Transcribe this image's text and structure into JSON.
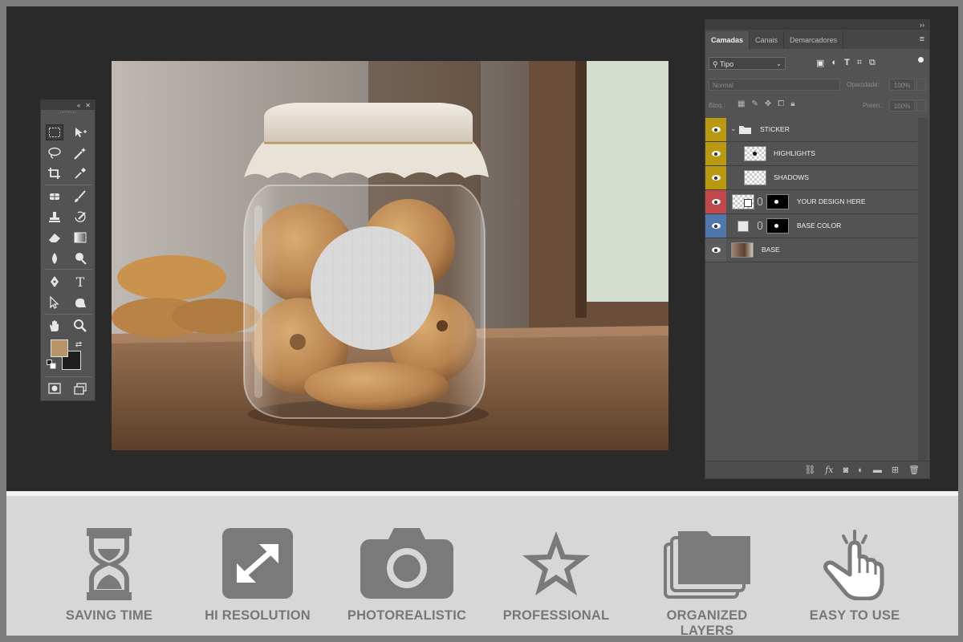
{
  "layers_panel": {
    "tabs": [
      {
        "label": "Camadas",
        "active": true
      },
      {
        "label": "Canais",
        "active": false
      },
      {
        "label": "Demarcadores",
        "active": false
      }
    ],
    "filter_label": "Tipo",
    "blend_mode": "Normal",
    "opacity_label": "Opacidade:",
    "opacity_value": "100%",
    "lock_label": "Bloq.:",
    "fill_label": "Preen.:",
    "fill_value": "100%",
    "layers": [
      {
        "name": "STICKER",
        "color": "#b8990f",
        "type": "group"
      },
      {
        "name": "HIGHLIGHTS",
        "color": "#b8990f",
        "type": "layer"
      },
      {
        "name": "SHADOWS",
        "color": "#b8990f",
        "type": "layer"
      },
      {
        "name": "YOUR DESIGN HERE",
        "color": "#c0484d",
        "type": "smart"
      },
      {
        "name": "BASE COLOR",
        "color": "#5077ab",
        "type": "fill"
      },
      {
        "name": "BASE",
        "color": "#5c5c5c",
        "type": "image"
      }
    ]
  },
  "toolbox": {
    "foreground_color": "#b8946a",
    "background_color": "#1e1e1e"
  },
  "features": [
    {
      "label": "SAVING TIME",
      "icon": "hourglass-icon"
    },
    {
      "label": "HI RESOLUTION",
      "icon": "expand-arrows-icon"
    },
    {
      "label": "PHOTOREALISTIC",
      "icon": "camera-icon"
    },
    {
      "label": "PROFESSIONAL",
      "icon": "star-icon"
    },
    {
      "label": "ORGANIZED LAYERS",
      "icon": "stacked-folders-icon"
    },
    {
      "label": "EASY TO USE",
      "icon": "tap-hand-icon"
    }
  ]
}
